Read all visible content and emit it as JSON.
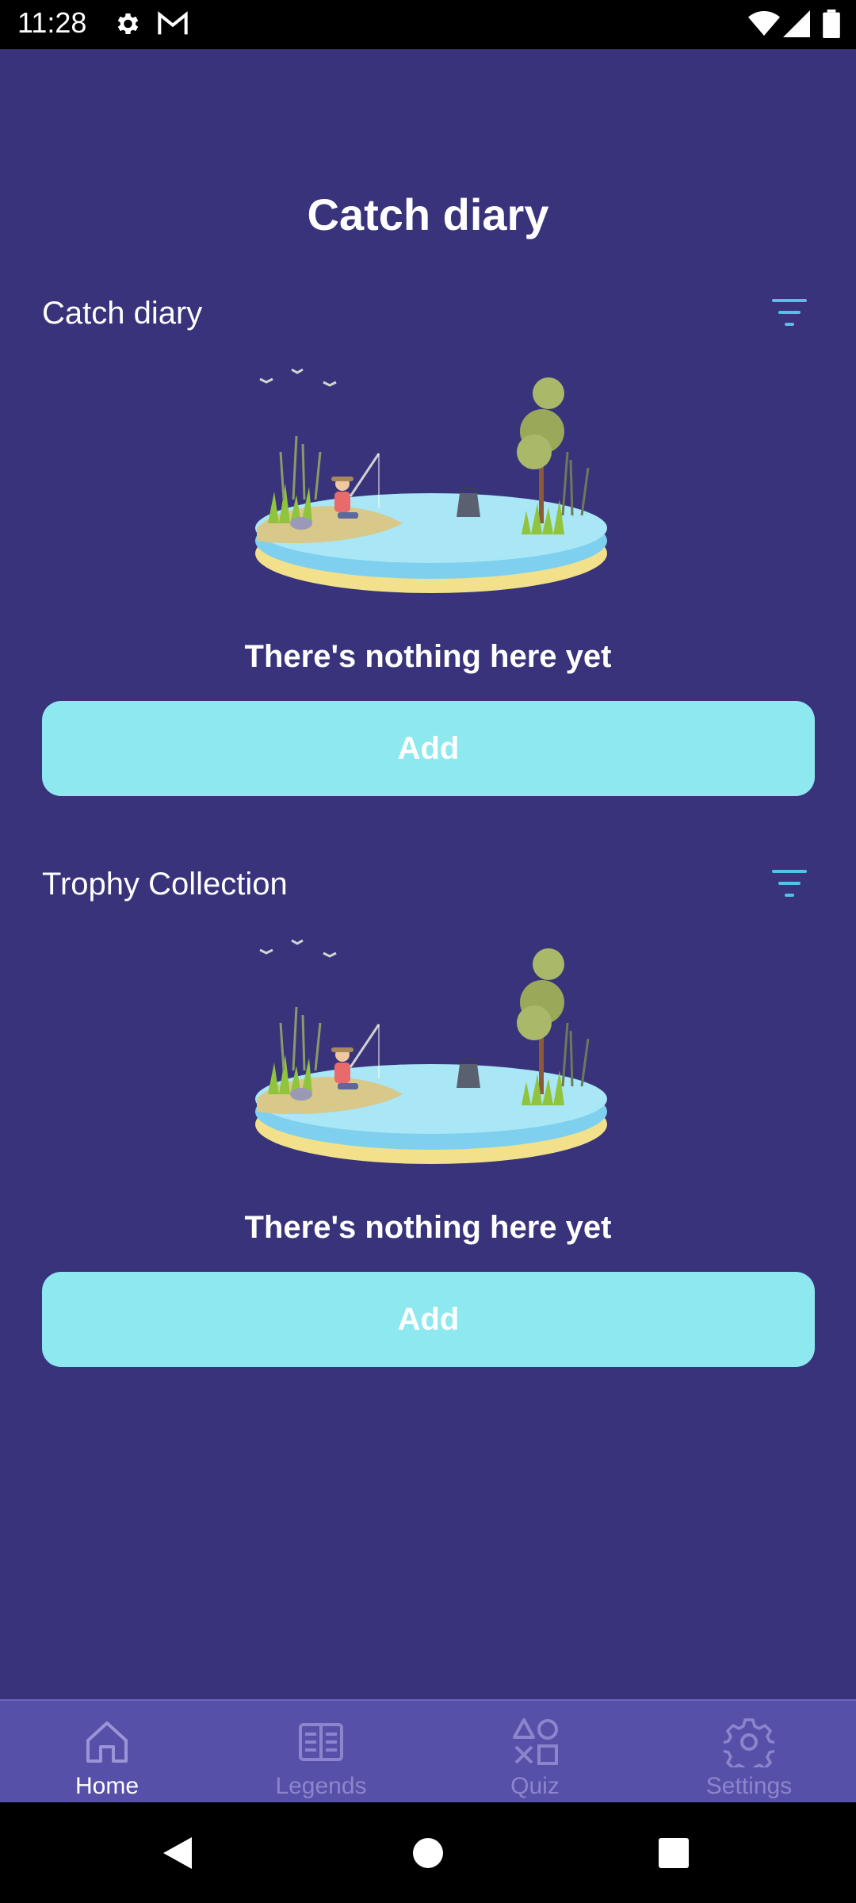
{
  "status_bar": {
    "time": "11:28",
    "icons": [
      "gear-icon",
      "gmail-icon",
      "wifi-icon",
      "signal-icon",
      "battery-icon"
    ]
  },
  "page": {
    "title": "Catch diary"
  },
  "sections": [
    {
      "title": "Catch diary",
      "empty_text": "There's nothing here yet",
      "add_label": "Add",
      "filter_icon": "filter-icon"
    },
    {
      "title": "Trophy Collection",
      "empty_text": "There's nothing here yet",
      "add_label": "Add",
      "filter_icon": "filter-icon"
    }
  ],
  "bottom_nav": {
    "items": [
      {
        "label": "Home",
        "icon": "home-icon",
        "active": true
      },
      {
        "label": "Legends",
        "icon": "book-icon",
        "active": false
      },
      {
        "label": "Quiz",
        "icon": "quiz-shapes-icon",
        "active": false
      },
      {
        "label": "Settings",
        "icon": "gear-icon",
        "active": false
      }
    ]
  },
  "system_nav": {
    "buttons": [
      "back-icon",
      "home-circle-icon",
      "recents-square-icon"
    ]
  },
  "colors": {
    "background": "#38337a",
    "button": "#8ee8f0",
    "nav_background": "#5650a8",
    "accent_filter": "#4fc3e8",
    "nav_inactive": "#8b86cc"
  }
}
